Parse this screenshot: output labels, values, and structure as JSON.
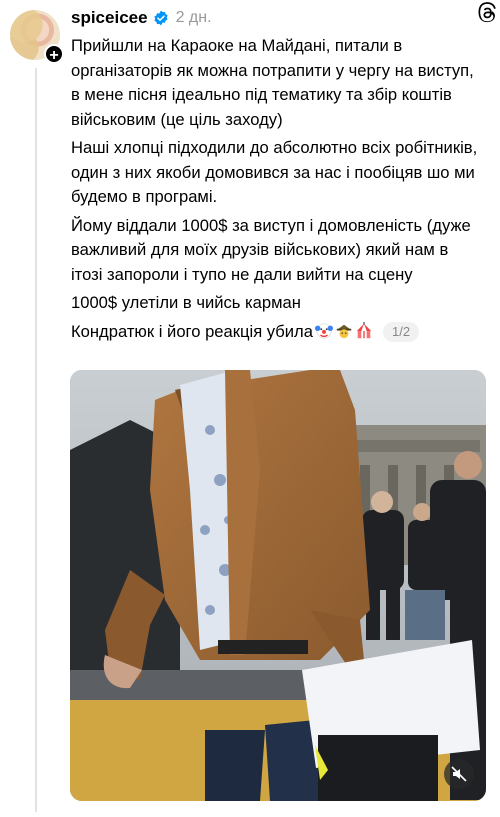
{
  "post": {
    "username": "spiceicee",
    "time": "2 дн.",
    "paragraphs": [
      "Прийшли на Караоке на Майдані, питали в організаторів як можна потрапити у чергу на виступ, в мене пісня ідеально під тематику та збір коштів військовим (це ціль заходу)",
      "Наші хлопці підходили до абсолютно всіх робітників, один з них якоби домовився за нас і пообіцяв шо ми будемо в програмі.",
      "Йому віддали 1000$ за виступ і домовленість (дуже важливий для моїх друзів військових) який нам в ітозі запороли і тупо не дали вийти на сцену",
      "1000$ улетіли в чийсь карман",
      "Кондратюк і його реакція убила"
    ],
    "counter": "1/2",
    "icons": {
      "avatar": "avatar",
      "follow": "plus-icon",
      "verified": "verified-badge-icon",
      "app": "threads-logo-icon",
      "emoji_1": "clown-face-emoji",
      "emoji_2": "detective-emoji",
      "emoji_3": "circus-tent-emoji",
      "mute": "speaker-muted-icon"
    },
    "colors": {
      "verified": "#0095f6",
      "secondary_text": "#999999",
      "thread_line": "#e3e3e3"
    }
  }
}
